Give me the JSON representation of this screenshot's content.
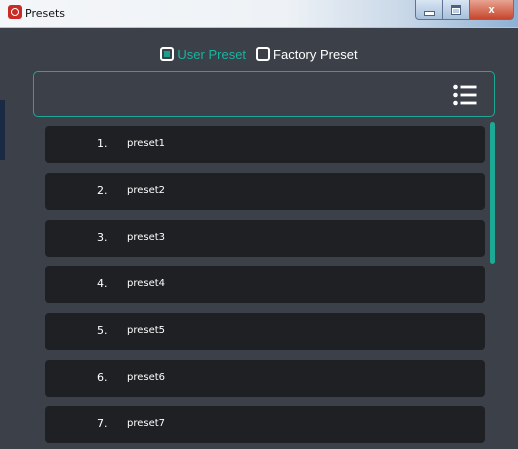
{
  "window": {
    "title": "Presets",
    "controls": {
      "minimize_icon": "minimize-icon",
      "maximize_icon": "maximize-icon",
      "close_label": "x"
    }
  },
  "preset_type": {
    "options": [
      {
        "label": "User Preset",
        "selected": true
      },
      {
        "label": "Factory Preset",
        "selected": false
      }
    ]
  },
  "header": {
    "menu_icon": "list-menu-icon"
  },
  "presets": [
    {
      "number": "1.",
      "name": "preset1"
    },
    {
      "number": "2.",
      "name": "preset2"
    },
    {
      "number": "3.",
      "name": "preset3"
    },
    {
      "number": "4.",
      "name": "preset4"
    },
    {
      "number": "5.",
      "name": "preset5"
    },
    {
      "number": "6.",
      "name": "preset6"
    },
    {
      "number": "7.",
      "name": "preset7"
    }
  ],
  "colors": {
    "background": "#3b4049",
    "row": "#1f2024",
    "accent": "#1ea896",
    "accent_text": "#1ab3a0",
    "text": "#ffffff"
  }
}
